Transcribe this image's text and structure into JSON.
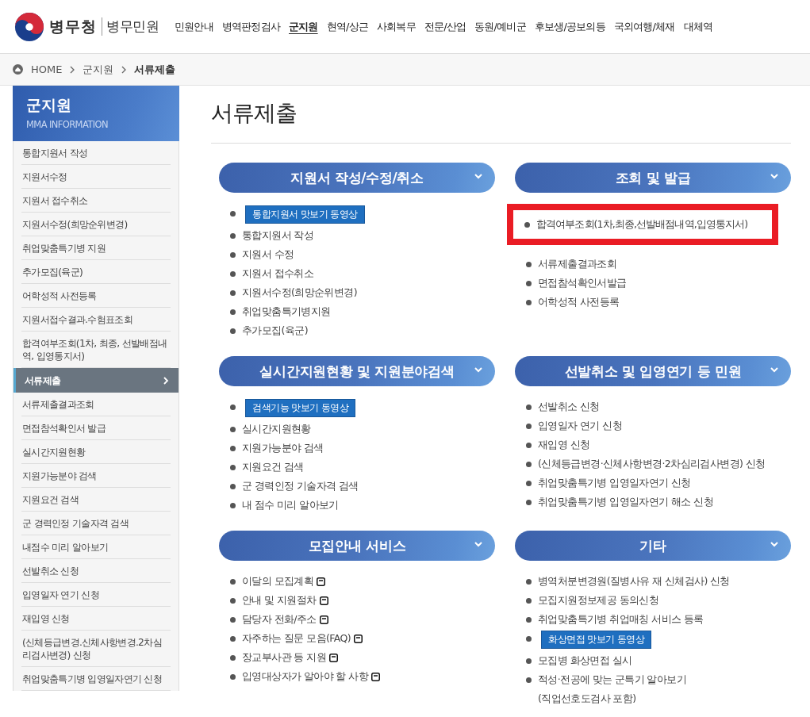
{
  "header": {
    "logo_main": "병무청",
    "logo_sub": "병무민원",
    "nav": [
      {
        "label": "민원안내",
        "selected": false
      },
      {
        "label": "병역판정검사",
        "selected": false
      },
      {
        "label": "군지원",
        "selected": true
      },
      {
        "label": "현역/상근",
        "selected": false
      },
      {
        "label": "사회복무",
        "selected": false
      },
      {
        "label": "전문/산업",
        "selected": false
      },
      {
        "label": "동원/예비군",
        "selected": false
      },
      {
        "label": "후보생/공보의등",
        "selected": false
      },
      {
        "label": "국외여행/체재",
        "selected": false
      },
      {
        "label": "대체역",
        "selected": false
      }
    ]
  },
  "breadcrumb": [
    "HOME",
    "군지원",
    "서류제출"
  ],
  "sidebar": {
    "title": "군지원",
    "subtitle": "MMA INFORMATION",
    "items": [
      {
        "label": "통합지원서 작성",
        "selected": false
      },
      {
        "label": "지원서수정",
        "selected": false
      },
      {
        "label": "지원서 접수취소",
        "selected": false
      },
      {
        "label": "지원서수정(희망순위변경)",
        "selected": false
      },
      {
        "label": "취업맞춤특기병 지원",
        "selected": false
      },
      {
        "label": "추가모집(육군)",
        "selected": false
      },
      {
        "label": "어학성적 사전등록",
        "selected": false
      },
      {
        "label": "지원서접수결과.수험표조회",
        "selected": false
      },
      {
        "label": "합격여부조회(1차, 최종, 선발배점내역, 입영통지서)",
        "selected": false
      },
      {
        "label": "서류제출",
        "selected": true
      },
      {
        "label": "서류제출결과조회",
        "selected": false
      },
      {
        "label": "면접참석확인서 발급",
        "selected": false
      },
      {
        "label": "실시간지원현황",
        "selected": false
      },
      {
        "label": "지원가능분야 검색",
        "selected": false
      },
      {
        "label": "지원요건 검색",
        "selected": false
      },
      {
        "label": "군 경력인정 기술자격 검색",
        "selected": false
      },
      {
        "label": "내점수 미리 알아보기",
        "selected": false
      },
      {
        "label": "선발취소 신청",
        "selected": false
      },
      {
        "label": "입영일자 연기 신청",
        "selected": false
      },
      {
        "label": "재입영 신청",
        "selected": false
      },
      {
        "label": "(신체등급변경.신체사항변경.2차심리검사변경) 신청",
        "selected": false
      },
      {
        "label": "취업맞춤특기병 입영일자연기 신청",
        "selected": false
      }
    ]
  },
  "page_title": "서류제출",
  "sections": [
    {
      "title": "지원서 작성/수정/취소",
      "items": [
        {
          "kind": "video",
          "label": "통합지원서 맛보기 동영상"
        },
        {
          "kind": "link",
          "label": "통합지원서 작성"
        },
        {
          "kind": "link",
          "label": "지원서 수정"
        },
        {
          "kind": "link",
          "label": "지원서 접수취소"
        },
        {
          "kind": "link",
          "label": "지원서수정(희망순위변경)"
        },
        {
          "kind": "link",
          "label": "취업맞춤특기병지원"
        },
        {
          "kind": "link",
          "label": "추가모집(육군)"
        }
      ]
    },
    {
      "title": "조회 및 발급",
      "items": [
        {
          "kind": "highlight",
          "label": "합격여부조회(1차,최종,선발배점내역,입영통지서)"
        },
        {
          "kind": "link",
          "label": "서류제출결과조회"
        },
        {
          "kind": "link",
          "label": "면접참석확인서발급"
        },
        {
          "kind": "link",
          "label": "어학성적 사전등록"
        }
      ]
    },
    {
      "title": "실시간지원현황 및 지원분야검색",
      "items": [
        {
          "kind": "video",
          "label": "검색기능 맛보기 동영상"
        },
        {
          "kind": "link",
          "label": "실시간지원현황"
        },
        {
          "kind": "link",
          "label": "지원가능분야 검색"
        },
        {
          "kind": "link",
          "label": "지원요건 검색"
        },
        {
          "kind": "link",
          "label": "군 경력인정 기술자격 검색"
        },
        {
          "kind": "link",
          "label": "내 점수 미리 알아보기"
        }
      ]
    },
    {
      "title": "선발취소 및 입영연기 등 민원",
      "items": [
        {
          "kind": "link",
          "label": "선발취소 신청"
        },
        {
          "kind": "link",
          "label": "입영일자 연기 신청"
        },
        {
          "kind": "link",
          "label": "재입영 신청"
        },
        {
          "kind": "link",
          "label": "(신체등급변경·신체사항변경·2차심리검사변경) 신청"
        },
        {
          "kind": "link",
          "label": "취업맞춤특기병 입영일자연기 신청"
        },
        {
          "kind": "link",
          "label": "취업맞춤특기병 입영일자연기 해소 신청"
        }
      ]
    },
    {
      "title": "모집안내 서비스",
      "items": [
        {
          "kind": "popup",
          "label": "이달의 모집계획"
        },
        {
          "kind": "popup",
          "label": "안내 및 지원절차"
        },
        {
          "kind": "popup",
          "label": "담당자 전화/주소"
        },
        {
          "kind": "popup",
          "label": "자주하는 질문 모음(FAQ)"
        },
        {
          "kind": "popup",
          "label": "장교부사관 등 지원"
        },
        {
          "kind": "popup",
          "label": "입영대상자가 알아야 할 사항"
        }
      ]
    },
    {
      "title": "기타",
      "items": [
        {
          "kind": "link",
          "label": "병역처분변경원(질병사유 재 신체검사) 신청"
        },
        {
          "kind": "link",
          "label": "모집지원정보제공 동의신청"
        },
        {
          "kind": "link",
          "label": "취업맞춤특기병 취업매칭 서비스 등록"
        },
        {
          "kind": "video",
          "label": "화상면접 맛보기 동영상"
        },
        {
          "kind": "link",
          "label": "모집병 화상면접 실시"
        },
        {
          "kind": "link",
          "label": "적성·전공에 맞는 군특기 알아보기\n(직업선호도검사 포함)"
        }
      ]
    }
  ]
}
